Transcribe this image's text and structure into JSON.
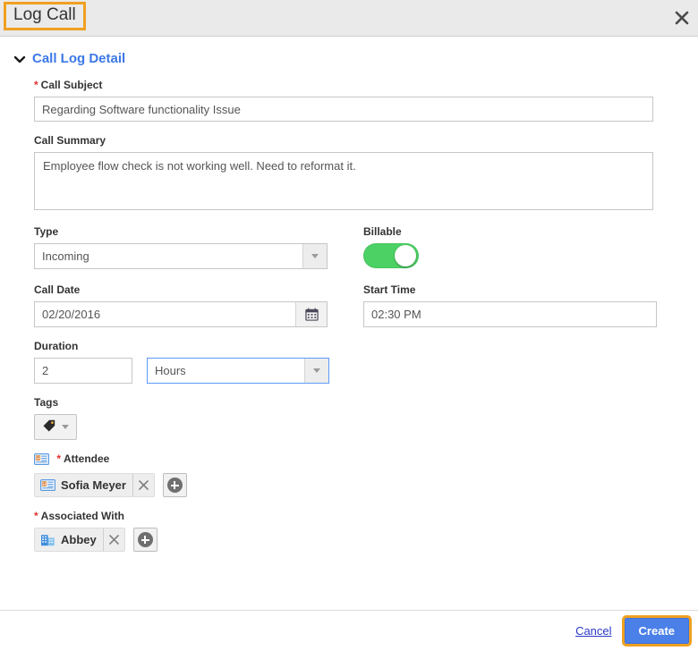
{
  "dialog": {
    "title": "Log Call",
    "close_icon": "close-icon"
  },
  "section": {
    "title": "Call Log Detail",
    "chevron_icon": "chevron-down-icon"
  },
  "fields": {
    "call_subject": {
      "label": "Call Subject",
      "required": "*",
      "value": "Regarding Software functionality Issue"
    },
    "call_summary": {
      "label": "Call Summary",
      "value": "Employee flow check is not working well. Need to reformat it."
    },
    "type": {
      "label": "Type",
      "value": "Incoming"
    },
    "billable": {
      "label": "Billable",
      "state": "on"
    },
    "call_date": {
      "label": "Call Date",
      "value": "02/20/2016",
      "calendar_icon": "calendar-icon"
    },
    "start_time": {
      "label": "Start Time",
      "value": "02:30 PM"
    },
    "duration": {
      "label": "Duration",
      "value": "2",
      "unit": "Hours"
    },
    "tags": {
      "label": "Tags",
      "tag_icon": "tag-icon"
    },
    "attendee": {
      "label": "Attendee",
      "required": "*",
      "icon": "contact-card-icon",
      "chips": [
        {
          "name": "Sofia Meyer",
          "icon": "contact-card-icon"
        }
      ]
    },
    "associated_with": {
      "label": "Associated With",
      "required": "*",
      "chips": [
        {
          "name": "Abbey",
          "icon": "company-building-icon"
        }
      ]
    }
  },
  "footer": {
    "cancel_label": "Cancel",
    "create_label": "Create"
  },
  "colors": {
    "accent_blue": "#3b78e7",
    "button_blue": "#4a80e8",
    "toggle_green": "#4cd164",
    "highlight_orange": "#f0a020",
    "required_red": "#e03030",
    "header_gray": "#eaeaea"
  }
}
